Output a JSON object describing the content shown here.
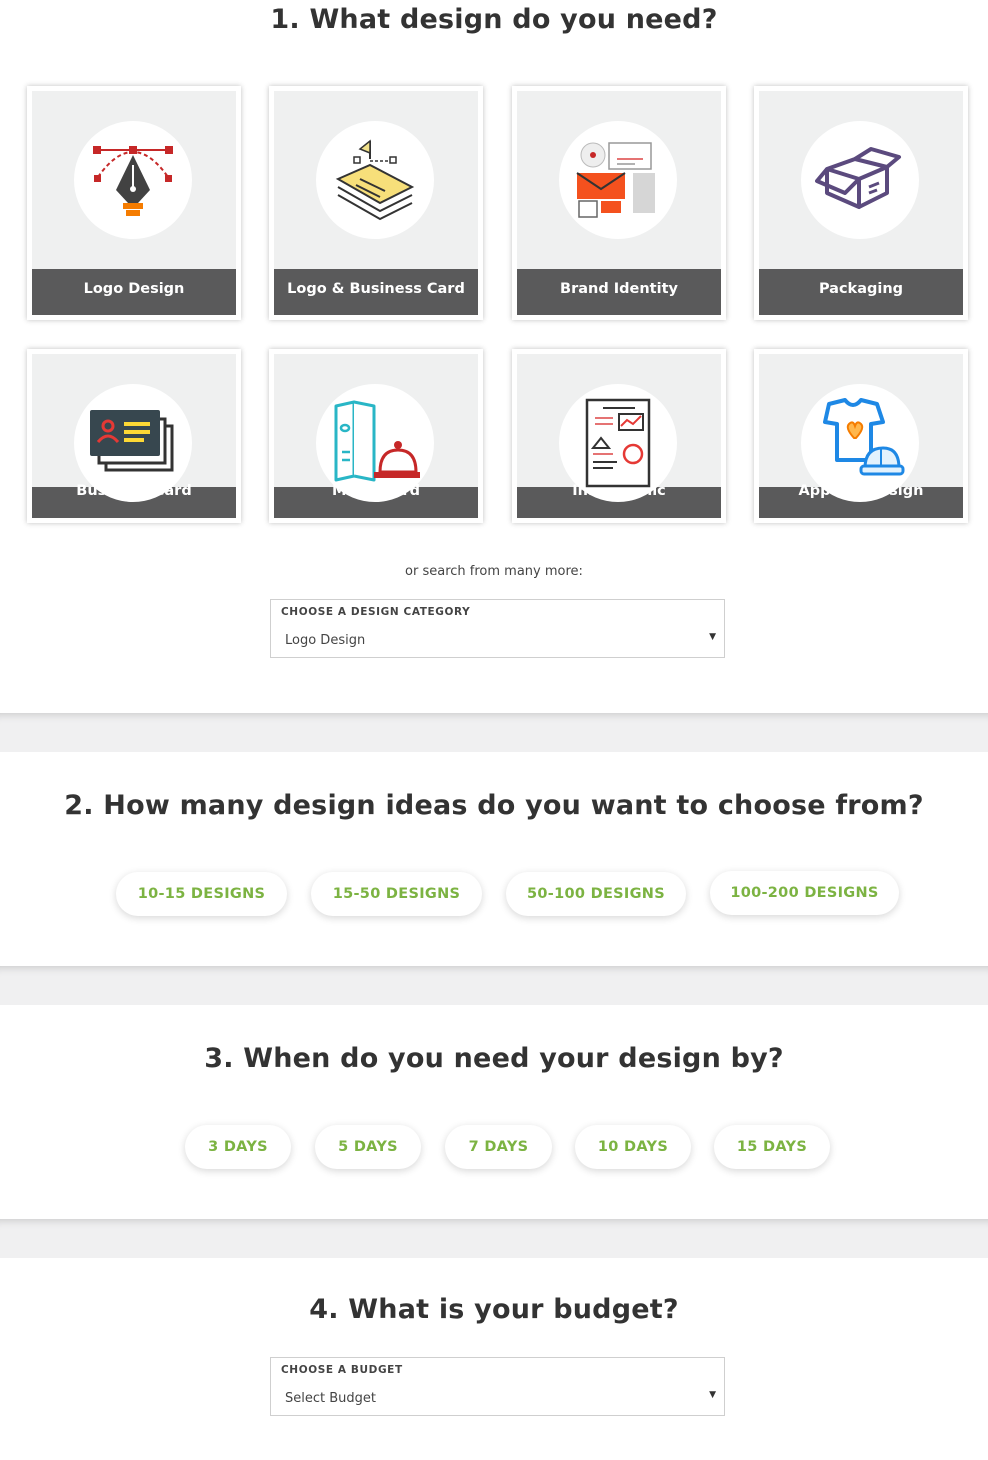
{
  "step1": {
    "title": "1. What design do you need?",
    "tiles": [
      {
        "label": "Logo Design",
        "icon": "pen-tool-icon"
      },
      {
        "label": "Logo & Business Card",
        "icon": "flag-cards-icon"
      },
      {
        "label": "Brand Identity",
        "icon": "stationery-icon"
      },
      {
        "label": "Packaging",
        "icon": "box-icon"
      },
      {
        "label": "Business Card",
        "icon": "id-card-icon"
      },
      {
        "label": "Menu Card",
        "icon": "menu-cloche-icon"
      },
      {
        "label": "Infographic",
        "icon": "infographic-sheet-icon"
      },
      {
        "label": "Apparel Design",
        "icon": "tshirt-cap-icon"
      }
    ],
    "search_hint": "or search from many more:",
    "category_select": {
      "label": "CHOOSE A DESIGN CATEGORY",
      "value": "Logo Design"
    }
  },
  "step2": {
    "title": "2. How many design ideas do you want to choose from?",
    "options": [
      "10-15 DESIGNS",
      "15-50 DESIGNS",
      "50-100 DESIGNS",
      "100-200 DESIGNS"
    ]
  },
  "step3": {
    "title": "3. When do you need your design by?",
    "options": [
      "3 DAYS",
      "5 DAYS",
      "7 DAYS",
      "10 DAYS",
      "15 DAYS"
    ]
  },
  "step4": {
    "title": "4. What is your budget?",
    "budget_select": {
      "label": "CHOOSE A BUDGET",
      "value": "Select Budget"
    }
  },
  "colors": {
    "accent_green": "#7cb342",
    "tile_label_bg": "#5a5a5b",
    "tile_bg": "#eff0f0"
  }
}
